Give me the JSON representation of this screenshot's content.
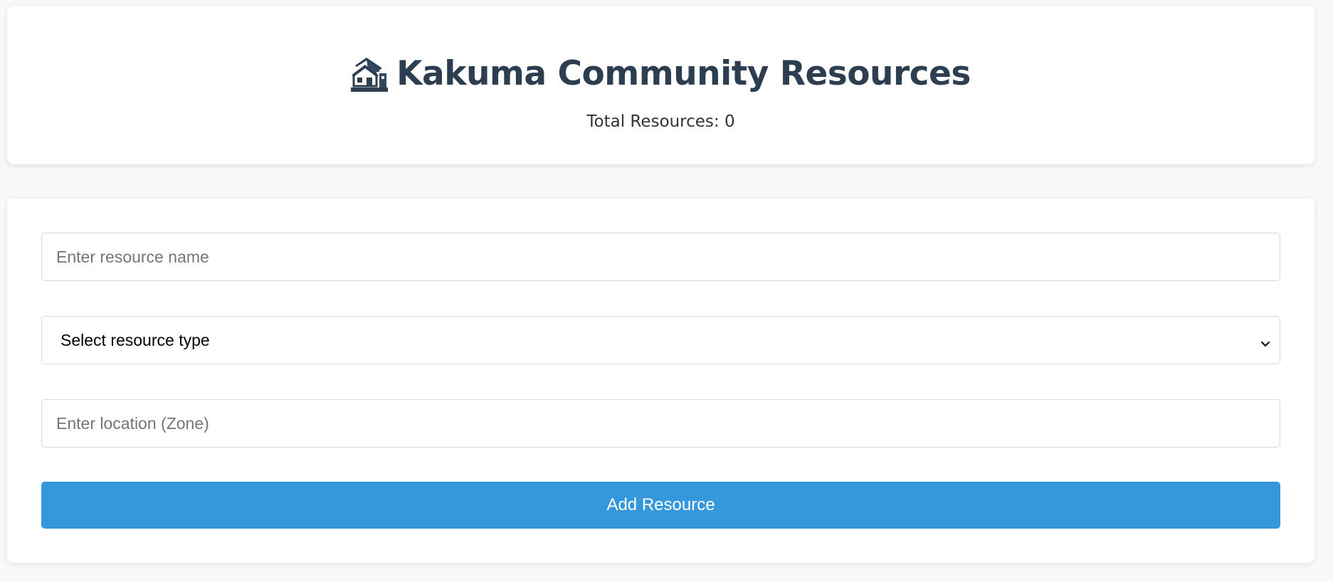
{
  "header": {
    "title": "Kakuma Community Resources",
    "title_icon": "houses-icon",
    "total_label": "Total Resources: 0"
  },
  "form": {
    "name_placeholder": "Enter resource name",
    "name_value": "",
    "type_selected": "Select resource type",
    "location_placeholder": "Enter location (Zone)",
    "location_value": "",
    "submit_label": "Add Resource"
  },
  "colors": {
    "title": "#2c3e50",
    "accent": "#3498db",
    "background": "#f8f8f8"
  }
}
